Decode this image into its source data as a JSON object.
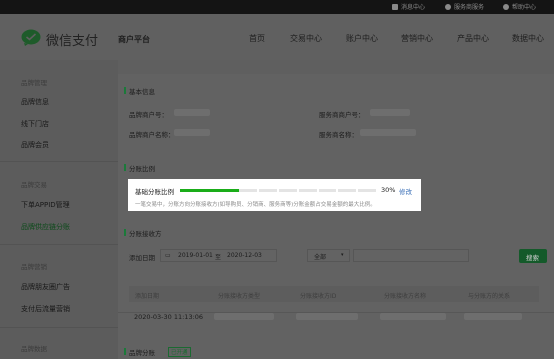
{
  "topbar": {
    "items": [
      {
        "icon": "message-icon",
        "label": "消息中心"
      },
      {
        "icon": "service-icon",
        "label": "服务商服务"
      },
      {
        "icon": "help-icon",
        "label": "帮助中心"
      }
    ]
  },
  "header": {
    "logo_text": "微信支付",
    "platform": "商户平台",
    "nav": [
      "首页",
      "交易中心",
      "账户中心",
      "营销中心",
      "产品中心",
      "数据中心"
    ]
  },
  "sidebar": {
    "groups": [
      {
        "title": "品牌管理",
        "items": [
          "品牌信息",
          "线下门店",
          "品牌会员"
        ]
      },
      {
        "title": "品牌交易",
        "items": [
          "下单APPID管理",
          "品牌供应链分账"
        ]
      },
      {
        "title": "品牌营销",
        "items": [
          "品牌朋友圈广告",
          "支付后流量营销"
        ]
      },
      {
        "title": "品牌数据",
        "items": []
      }
    ],
    "active_item": "品牌供应链分账"
  },
  "basic_info": {
    "title": "基本信息",
    "fields": [
      {
        "label": "品牌商户号："
      },
      {
        "label": "服务商商户号："
      },
      {
        "label": "品牌商户名称："
      },
      {
        "label": "服务商名称："
      }
    ]
  },
  "ratio": {
    "title": "分账比例",
    "label": "基础分账比例",
    "percent_text": "30%",
    "percent": 0.3,
    "edit_label": "修改",
    "description": "一笔交易中，分账方向分账接收方(如导购员、分销商、服务商等)分账金额占交易金额的最大比例。",
    "fill_color": "#1aad19",
    "track_color": "#e4e4e4"
  },
  "receivers": {
    "title": "分账接收方",
    "date_label": "添加日期",
    "date_from": "2019-01-01",
    "date_sep": "至",
    "date_to": "2020-12-03",
    "select_value": "全部",
    "search_label": "搜索",
    "columns": [
      "添加日期",
      "分账接收方类型",
      "分账接收方ID",
      "分账接收方名称",
      "与分账方的关系"
    ],
    "rows": [
      {
        "date": "2020-03-30 11:13:06"
      }
    ]
  },
  "brand_ledger": {
    "title": "品牌分账",
    "badge": "已开通"
  },
  "colors": {
    "brand_green": "#1aad19",
    "link_blue": "#3a6fb7"
  }
}
